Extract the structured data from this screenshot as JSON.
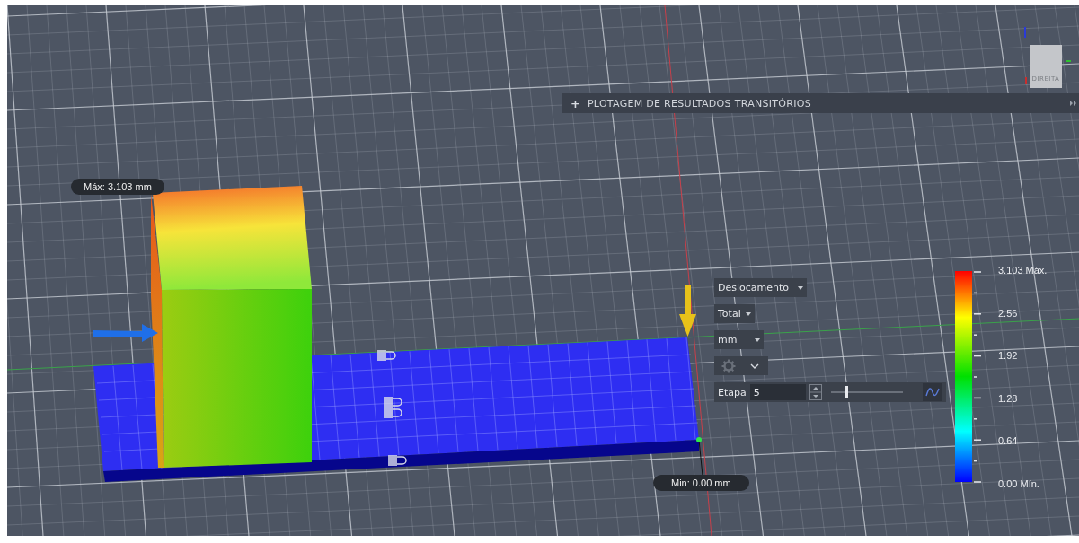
{
  "viewcube": {
    "face_label": "DIREITA"
  },
  "transient_panel": {
    "expand_icon": "+",
    "title": "PLOTAGEM DE RESULTADOS TRANSITÓRIOS"
  },
  "probes": [
    {
      "kind": "max",
      "text": "Máx: 3.103 mm"
    },
    {
      "kind": "min",
      "text": "Min: 0.00 mm"
    }
  ],
  "result_controls": {
    "result_type": "Deslocamento",
    "component": "Total",
    "unit": "mm",
    "step_label": "Etapa",
    "step_value": "5",
    "step_slider": {
      "level": 0.2
    }
  },
  "legend": {
    "ticks": [
      "3.103 Máx.",
      "2.56",
      "1.92",
      "1.28",
      "0.64",
      "0.00 Mín."
    ]
  }
}
